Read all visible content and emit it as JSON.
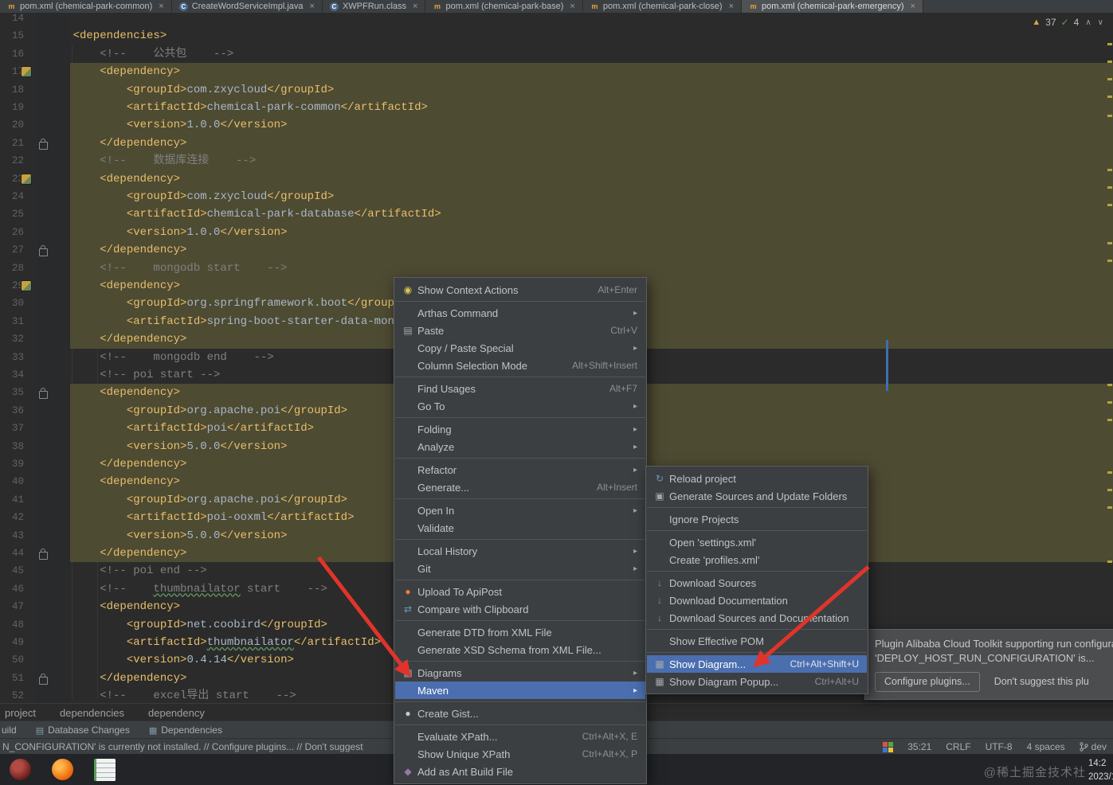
{
  "colors": {
    "bg": "#2b2b2b",
    "panel": "#3c3f41",
    "selection": "#4b6eaf",
    "warnband": "#4e4b33",
    "xmltag": "#e8bf6a",
    "xmltext": "#a9b7c6",
    "xmlcomment": "#808080",
    "linenum": "#606366",
    "arrow": "#e0342b"
  },
  "tabs": {
    "items": [
      {
        "label": "pom.xml (chemical-park-common)",
        "icon": "maven",
        "active": false
      },
      {
        "label": "CreateWordServiceImpl.java",
        "icon": "class",
        "active": false
      },
      {
        "label": "XWPFRun.class",
        "icon": "class",
        "active": false
      },
      {
        "label": "pom.xml (chemical-park-base)",
        "icon": "maven",
        "active": false
      },
      {
        "label": "pom.xml (chemical-park-close)",
        "icon": "maven",
        "active": false
      },
      {
        "label": "pom.xml (chemical-park-emergency)",
        "icon": "maven",
        "active": true
      }
    ]
  },
  "inspections": {
    "warnings": "37",
    "passed": "4"
  },
  "editor": {
    "lines": [
      {
        "n": 14,
        "parts": []
      },
      {
        "n": 15,
        "parts": [
          {
            "c": "tg",
            "t": "    <dependencies>"
          }
        ]
      },
      {
        "n": 16,
        "parts": [
          {
            "c": "cm",
            "t": "        <!--    公共包    -->"
          }
        ]
      },
      {
        "n": 17,
        "hl": 1,
        "gi": 1,
        "parts": [
          {
            "c": "tg",
            "t": "        <dependency>"
          }
        ]
      },
      {
        "n": 18,
        "hl": 1,
        "parts": [
          {
            "c": "tg",
            "t": "            <groupId>"
          },
          {
            "c": "tx",
            "t": "com.zxycloud"
          },
          {
            "c": "tg",
            "t": "</groupId>"
          }
        ]
      },
      {
        "n": 19,
        "hl": 1,
        "parts": [
          {
            "c": "tg",
            "t": "            <artifactId>"
          },
          {
            "c": "tx",
            "t": "chemical-park-common"
          },
          {
            "c": "tg",
            "t": "</artifactId>"
          }
        ]
      },
      {
        "n": 20,
        "hl": 1,
        "parts": [
          {
            "c": "tg",
            "t": "            <version>"
          },
          {
            "c": "tx",
            "t": "1.0.0"
          },
          {
            "c": "tg",
            "t": "</version>"
          }
        ]
      },
      {
        "n": 21,
        "hl": 1,
        "lk": 1,
        "parts": [
          {
            "c": "tg",
            "t": "        </dependency>"
          }
        ]
      },
      {
        "n": 22,
        "hl": 1,
        "parts": [
          {
            "c": "cm",
            "t": "        <!--    数据库连接    -->"
          }
        ]
      },
      {
        "n": 23,
        "hl": 1,
        "gi": 1,
        "parts": [
          {
            "c": "tg",
            "t": "        <dependency>"
          }
        ]
      },
      {
        "n": 24,
        "hl": 1,
        "parts": [
          {
            "c": "tg",
            "t": "            <groupId>"
          },
          {
            "c": "tx",
            "t": "com.zxycloud"
          },
          {
            "c": "tg",
            "t": "</groupId>"
          }
        ]
      },
      {
        "n": 25,
        "hl": 1,
        "parts": [
          {
            "c": "tg",
            "t": "            <artifactId>"
          },
          {
            "c": "tx",
            "t": "chemical-park-database"
          },
          {
            "c": "tg",
            "t": "</artifactId>"
          }
        ]
      },
      {
        "n": 26,
        "hl": 1,
        "parts": [
          {
            "c": "tg",
            "t": "            <version>"
          },
          {
            "c": "tx",
            "t": "1.0.0"
          },
          {
            "c": "tg",
            "t": "</version>"
          }
        ]
      },
      {
        "n": 27,
        "hl": 1,
        "lk": 1,
        "parts": [
          {
            "c": "tg",
            "t": "        </dependency>"
          }
        ]
      },
      {
        "n": 28,
        "hl": 1,
        "parts": [
          {
            "c": "cm",
            "t": "        <!--    mongodb start    -->"
          }
        ]
      },
      {
        "n": 29,
        "hl": 1,
        "gi": 1,
        "parts": [
          {
            "c": "tg",
            "t": "        <dependency>"
          }
        ]
      },
      {
        "n": 30,
        "hl": 1,
        "parts": [
          {
            "c": "tg",
            "t": "            <groupId>"
          },
          {
            "c": "tx",
            "t": "org.springframework.boot"
          },
          {
            "c": "tg",
            "t": "</groupId>"
          }
        ]
      },
      {
        "n": 31,
        "hl": 1,
        "parts": [
          {
            "c": "tg",
            "t": "            <artifactId>"
          },
          {
            "c": "tx",
            "t": "spring-boot-starter-data-mongodb"
          },
          {
            "c": "tg",
            "t": "</artifactId>"
          }
        ]
      },
      {
        "n": 32,
        "hl": 1,
        "parts": [
          {
            "c": "tg",
            "t": "        </dependency>"
          }
        ]
      },
      {
        "n": 33,
        "parts": [
          {
            "c": "cm",
            "t": "        <!--    mongodb end    -->"
          }
        ]
      },
      {
        "n": 34,
        "parts": [
          {
            "c": "cm",
            "t": "        <!-- poi start -->"
          }
        ]
      },
      {
        "n": 35,
        "hl": 1,
        "lk": 1,
        "parts": [
          {
            "c": "tg",
            "t": "        <dependency>"
          }
        ]
      },
      {
        "n": 36,
        "hl": 1,
        "parts": [
          {
            "c": "tg",
            "t": "            <groupId>"
          },
          {
            "c": "tx",
            "t": "org.apache.poi"
          },
          {
            "c": "tg",
            "t": "</groupId>"
          }
        ]
      },
      {
        "n": 37,
        "hl": 1,
        "parts": [
          {
            "c": "tg",
            "t": "            <artifactId>"
          },
          {
            "c": "tx",
            "t": "poi"
          },
          {
            "c": "tg",
            "t": "</artifactId>"
          }
        ]
      },
      {
        "n": 38,
        "hl": 1,
        "parts": [
          {
            "c": "tg",
            "t": "            <version>"
          },
          {
            "c": "tx",
            "t": "5.0.0"
          },
          {
            "c": "tg",
            "t": "</version>"
          }
        ]
      },
      {
        "n": 39,
        "hl": 1,
        "parts": [
          {
            "c": "tg",
            "t": "        </dependency>"
          }
        ]
      },
      {
        "n": 40,
        "hl": 1,
        "parts": [
          {
            "c": "tg",
            "t": "        <dependency>"
          }
        ]
      },
      {
        "n": 41,
        "hl": 1,
        "parts": [
          {
            "c": "tg",
            "t": "            <groupId>"
          },
          {
            "c": "tx",
            "t": "org.apache.poi"
          },
          {
            "c": "tg",
            "t": "</groupId>"
          }
        ]
      },
      {
        "n": 42,
        "hl": 1,
        "parts": [
          {
            "c": "tg",
            "t": "            <artifactId>"
          },
          {
            "c": "tx",
            "t": "poi-ooxml"
          },
          {
            "c": "tg",
            "t": "</artifactId>"
          }
        ]
      },
      {
        "n": 43,
        "hl": 1,
        "parts": [
          {
            "c": "tg",
            "t": "            <version>"
          },
          {
            "c": "tx",
            "t": "5.0.0"
          },
          {
            "c": "tg",
            "t": "</version>"
          }
        ]
      },
      {
        "n": 44,
        "hl": 1,
        "lk": 1,
        "parts": [
          {
            "c": "tg",
            "t": "        </dependency>"
          }
        ]
      },
      {
        "n": 45,
        "parts": [
          {
            "c": "cm",
            "t": "        <!-- poi end -->"
          }
        ]
      },
      {
        "n": 46,
        "parts": [
          {
            "c": "cm",
            "t": "        <!--    "
          },
          {
            "c": "cm u",
            "t": "thumbnailator"
          },
          {
            "c": "cm",
            "t": " start    -->"
          }
        ]
      },
      {
        "n": 47,
        "parts": [
          {
            "c": "tg",
            "t": "        <dependency>"
          }
        ]
      },
      {
        "n": 48,
        "parts": [
          {
            "c": "tg",
            "t": "            <groupId>"
          },
          {
            "c": "tx",
            "t": "net.coobird"
          },
          {
            "c": "tg",
            "t": "</groupId>"
          }
        ]
      },
      {
        "n": 49,
        "parts": [
          {
            "c": "tg",
            "t": "            <artifactId>"
          },
          {
            "c": "tx u",
            "t": "thumbnailator"
          },
          {
            "c": "tg",
            "t": "</artifactId>"
          }
        ]
      },
      {
        "n": 50,
        "parts": [
          {
            "c": "tg",
            "t": "            <version>"
          },
          {
            "c": "tx",
            "t": "0.4.14"
          },
          {
            "c": "tg",
            "t": "</version>"
          }
        ]
      },
      {
        "n": 51,
        "lk": 1,
        "parts": [
          {
            "c": "tg",
            "t": "        </dependency>"
          }
        ]
      },
      {
        "n": 52,
        "parts": [
          {
            "c": "cm",
            "t": "        <!--    excel导出 start    -->"
          }
        ]
      }
    ],
    "stripe_marks": [
      38,
      60,
      82,
      104,
      128,
      196,
      218,
      240,
      288,
      310,
      466,
      488,
      510,
      576,
      598,
      620,
      688
    ]
  },
  "context_menu": {
    "items": [
      {
        "icon": "bulb",
        "label": "Show Context Actions",
        "shortcut": "Alt+Enter"
      },
      {
        "sep": 1
      },
      {
        "label": "Arthas Command",
        "submenu": 1
      },
      {
        "icon": "paste",
        "label": "Paste",
        "shortcut": "Ctrl+V"
      },
      {
        "label": "Copy / Paste Special",
        "submenu": 1
      },
      {
        "label": "Column Selection Mode",
        "shortcut": "Alt+Shift+Insert"
      },
      {
        "sep": 1
      },
      {
        "label": "Find Usages",
        "shortcut": "Alt+F7"
      },
      {
        "label": "Go To",
        "submenu": 1
      },
      {
        "sep": 1
      },
      {
        "label": "Folding",
        "submenu": 1
      },
      {
        "label": "Analyze",
        "submenu": 1
      },
      {
        "sep": 1
      },
      {
        "label": "Refactor",
        "submenu": 1
      },
      {
        "label": "Generate...",
        "shortcut": "Alt+Insert"
      },
      {
        "sep": 1
      },
      {
        "label": "Open In",
        "submenu": 1
      },
      {
        "label": "Validate"
      },
      {
        "sep": 1
      },
      {
        "label": "Local History",
        "submenu": 1
      },
      {
        "label": "Git",
        "submenu": 1
      },
      {
        "sep": 1
      },
      {
        "icon": "apipost",
        "label": "Upload To ApiPost"
      },
      {
        "icon": "compare",
        "label": "Compare with Clipboard"
      },
      {
        "sep": 1
      },
      {
        "label": "Generate DTD from XML File"
      },
      {
        "label": "Generate XSD Schema from XML File..."
      },
      {
        "sep": 1
      },
      {
        "icon": "diagram",
        "label": "Diagrams",
        "submenu": 1
      },
      {
        "label": "Maven",
        "submenu": 1,
        "selected": 1
      },
      {
        "sep": 1
      },
      {
        "icon": "github",
        "label": "Create Gist..."
      },
      {
        "sep": 1
      },
      {
        "label": "Evaluate XPath...",
        "shortcut": "Ctrl+Alt+X, E"
      },
      {
        "label": "Show Unique XPath",
        "shortcut": "Ctrl+Alt+X, P"
      },
      {
        "icon": "ant",
        "label": "Add as Ant Build File"
      }
    ]
  },
  "maven_menu": {
    "items": [
      {
        "icon": "reload",
        "label": "Reload project"
      },
      {
        "icon": "sources",
        "label": "Generate Sources and Update Folders"
      },
      {
        "sep": 1
      },
      {
        "label": "Ignore Projects"
      },
      {
        "sep": 1
      },
      {
        "label": "Open 'settings.xml'"
      },
      {
        "label": "Create 'profiles.xml'"
      },
      {
        "sep": 1
      },
      {
        "icon": "download",
        "label": "Download Sources"
      },
      {
        "icon": "download",
        "label": "Download Documentation"
      },
      {
        "icon": "download",
        "label": "Download Sources and Documentation"
      },
      {
        "sep": 1
      },
      {
        "label": "Show Effective POM"
      },
      {
        "sep": 1
      },
      {
        "icon": "diagram",
        "label": "Show Diagram...",
        "shortcut": "Ctrl+Alt+Shift+U",
        "selected": 1
      },
      {
        "icon": "diagram",
        "label": "Show Diagram Popup...",
        "shortcut": "Ctrl+Alt+U"
      }
    ]
  },
  "notification": {
    "text": "Plugin Alibaba Cloud Toolkit supporting run configuration 'DEPLOY_HOST_RUN_CONFIGURATION' is...",
    "configure_label": "Configure plugins...",
    "dismiss_label": "Don't suggest this plu"
  },
  "breadcrumbs": {
    "items": [
      "project",
      "dependencies",
      "dependency"
    ]
  },
  "tool_window_bar": {
    "tabs": [
      {
        "icon": "",
        "label": "uild"
      },
      {
        "icon": "db",
        "label": "Database Changes"
      },
      {
        "icon": "deps",
        "label": "Dependencies"
      }
    ]
  },
  "status_bar": {
    "message": "N_CONFIGURATION' is currently not installed. // Configure plugins... // Don't suggest",
    "caret": "35:21",
    "line_ending": "CRLF",
    "encoding": "UTF-8",
    "indent": "4 spaces",
    "branch": "dev"
  },
  "taskbar": {
    "clock_time": "14:2",
    "clock_date": "2023/1",
    "watermark": "@稀土掘金技术社"
  }
}
